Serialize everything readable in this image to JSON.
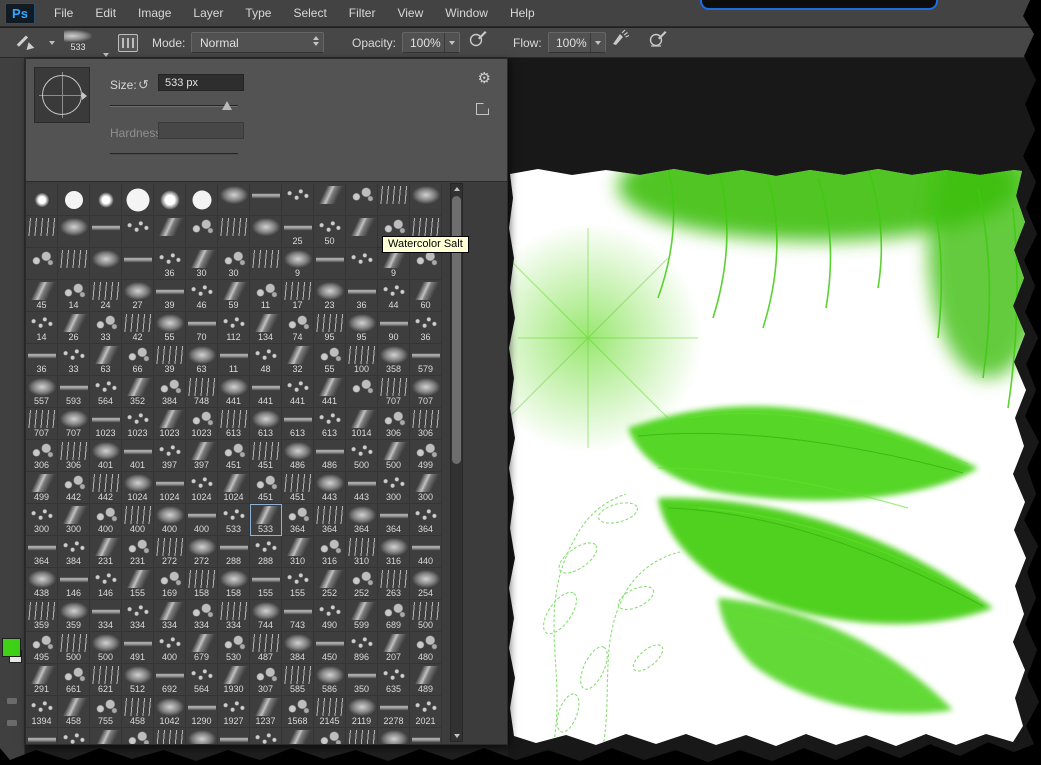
{
  "window": {
    "title_logo": "Ps"
  },
  "menu": {
    "items": [
      "File",
      "Edit",
      "Image",
      "Layer",
      "Type",
      "Select",
      "Filter",
      "View",
      "Window",
      "Help"
    ]
  },
  "options_bar": {
    "brush_preview_size": "533",
    "mode_label": "Mode:",
    "mode_value": "Normal",
    "opacity_label": "Opacity:",
    "opacity_value": "100%",
    "flow_label": "Flow:",
    "flow_value": "100%"
  },
  "brush_panel": {
    "size_label": "Size:",
    "size_value": "533 px",
    "hardness_label": "Hardness:",
    "tooltip": "Watercolor Salt"
  },
  "icons": {
    "gear": "⚙",
    "reset_size": "↺"
  },
  "colors": {
    "foreground_green": "#3fd117",
    "tooltip_bg": "#ffffd6",
    "highlight_border": "#1d6ce0"
  },
  "brush_grid": {
    "columns": 13,
    "selected_cell": {
      "row": 10,
      "col": 7
    },
    "rows": [
      [
        "",
        "",
        "",
        "",
        "",
        "",
        "",
        "",
        "",
        "",
        "",
        "",
        ""
      ],
      [
        "",
        "",
        "",
        "",
        "",
        "",
        "",
        "",
        "25",
        "50",
        "",
        "",
        ""
      ],
      [
        "",
        "",
        "",
        "",
        "36",
        "30",
        "30",
        "",
        "9",
        "",
        "",
        "9",
        ""
      ],
      [
        "45",
        "14",
        "24",
        "27",
        "39",
        "46",
        "59",
        "11",
        "17",
        "23",
        "36",
        "44",
        "60"
      ],
      [
        "14",
        "26",
        "33",
        "42",
        "55",
        "70",
        "112",
        "134",
        "74",
        "95",
        "95",
        "90",
        "36"
      ],
      [
        "36",
        "33",
        "63",
        "66",
        "39",
        "63",
        "11",
        "48",
        "32",
        "55",
        "100",
        "358",
        "579"
      ],
      [
        "557",
        "593",
        "564",
        "352",
        "384",
        "748",
        "441",
        "441",
        "441",
        "441",
        "",
        "707",
        "707"
      ],
      [
        "707",
        "707",
        "1023",
        "1023",
        "1023",
        "1023",
        "613",
        "613",
        "613",
        "613",
        "1014",
        "306",
        "306"
      ],
      [
        "306",
        "306",
        "401",
        "401",
        "397",
        "397",
        "451",
        "451",
        "486",
        "486",
        "500",
        "500",
        "499"
      ],
      [
        "499",
        "442",
        "442",
        "1024",
        "1024",
        "1024",
        "1024",
        "451",
        "451",
        "443",
        "443",
        "300",
        "300"
      ],
      [
        "300",
        "300",
        "400",
        "400",
        "400",
        "400",
        "533",
        "533",
        "364",
        "364",
        "364",
        "364",
        "364"
      ],
      [
        "364",
        "384",
        "231",
        "231",
        "272",
        "272",
        "288",
        "288",
        "310",
        "316",
        "310",
        "316",
        "440"
      ],
      [
        "438",
        "146",
        "146",
        "155",
        "169",
        "158",
        "158",
        "155",
        "155",
        "252",
        "252",
        "263",
        "254"
      ],
      [
        "359",
        "359",
        "334",
        "334",
        "334",
        "334",
        "334",
        "744",
        "743",
        "490",
        "599",
        "689",
        "500"
      ],
      [
        "495",
        "500",
        "500",
        "491",
        "400",
        "679",
        "530",
        "487",
        "384",
        "450",
        "896",
        "207",
        "480"
      ],
      [
        "291",
        "661",
        "621",
        "512",
        "692",
        "564",
        "1930",
        "307",
        "585",
        "586",
        "350",
        "635",
        "489"
      ],
      [
        "1394",
        "458",
        "755",
        "458",
        "1042",
        "1290",
        "1927",
        "1237",
        "1568",
        "2145",
        "2119",
        "2278",
        "2021"
      ],
      [
        "",
        "",
        "",
        "",
        "",
        "",
        "",
        "",
        "",
        "",
        "",
        "",
        ""
      ]
    ]
  }
}
